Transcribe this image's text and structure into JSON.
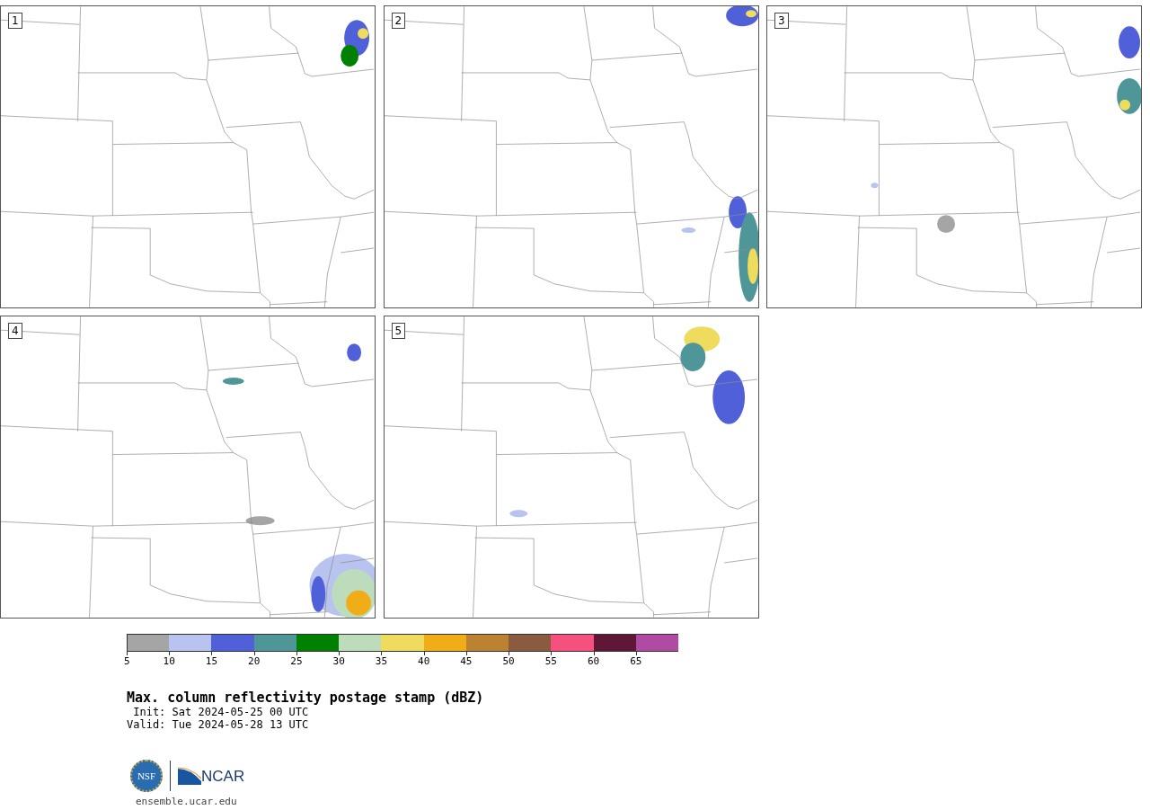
{
  "panels": [
    {
      "label": "1"
    },
    {
      "label": "2"
    },
    {
      "label": "3"
    },
    {
      "label": "4"
    },
    {
      "label": "5"
    }
  ],
  "colorbar": {
    "segments": [
      {
        "label": "5",
        "color": "#a5a5a5"
      },
      {
        "label": "10",
        "color": "#b8c3ef"
      },
      {
        "label": "15",
        "color": "#5060d8"
      },
      {
        "label": "20",
        "color": "#4e9698"
      },
      {
        "label": "25",
        "color": "#008000"
      },
      {
        "label": "30",
        "color": "#bcdcbb"
      },
      {
        "label": "35",
        "color": "#efdb5e"
      },
      {
        "label": "40",
        "color": "#f0ad17"
      },
      {
        "label": "45",
        "color": "#bb8231"
      },
      {
        "label": "50",
        "color": "#8b5b3f"
      },
      {
        "label": "55",
        "color": "#f5507e"
      },
      {
        "label": "60",
        "color": "#5f1637"
      },
      {
        "label": "65",
        "color": "#b14aa3"
      }
    ]
  },
  "title": "Max. column reflectivity postage stamp (dBZ)",
  "init": " Init: Sat 2024-05-25 00 UTC",
  "valid": "Valid: Tue 2024-05-28 13 UTC",
  "logo": {
    "left": "NSF",
    "right": "NCAR"
  },
  "url": "ensemble.ucar.edu"
}
